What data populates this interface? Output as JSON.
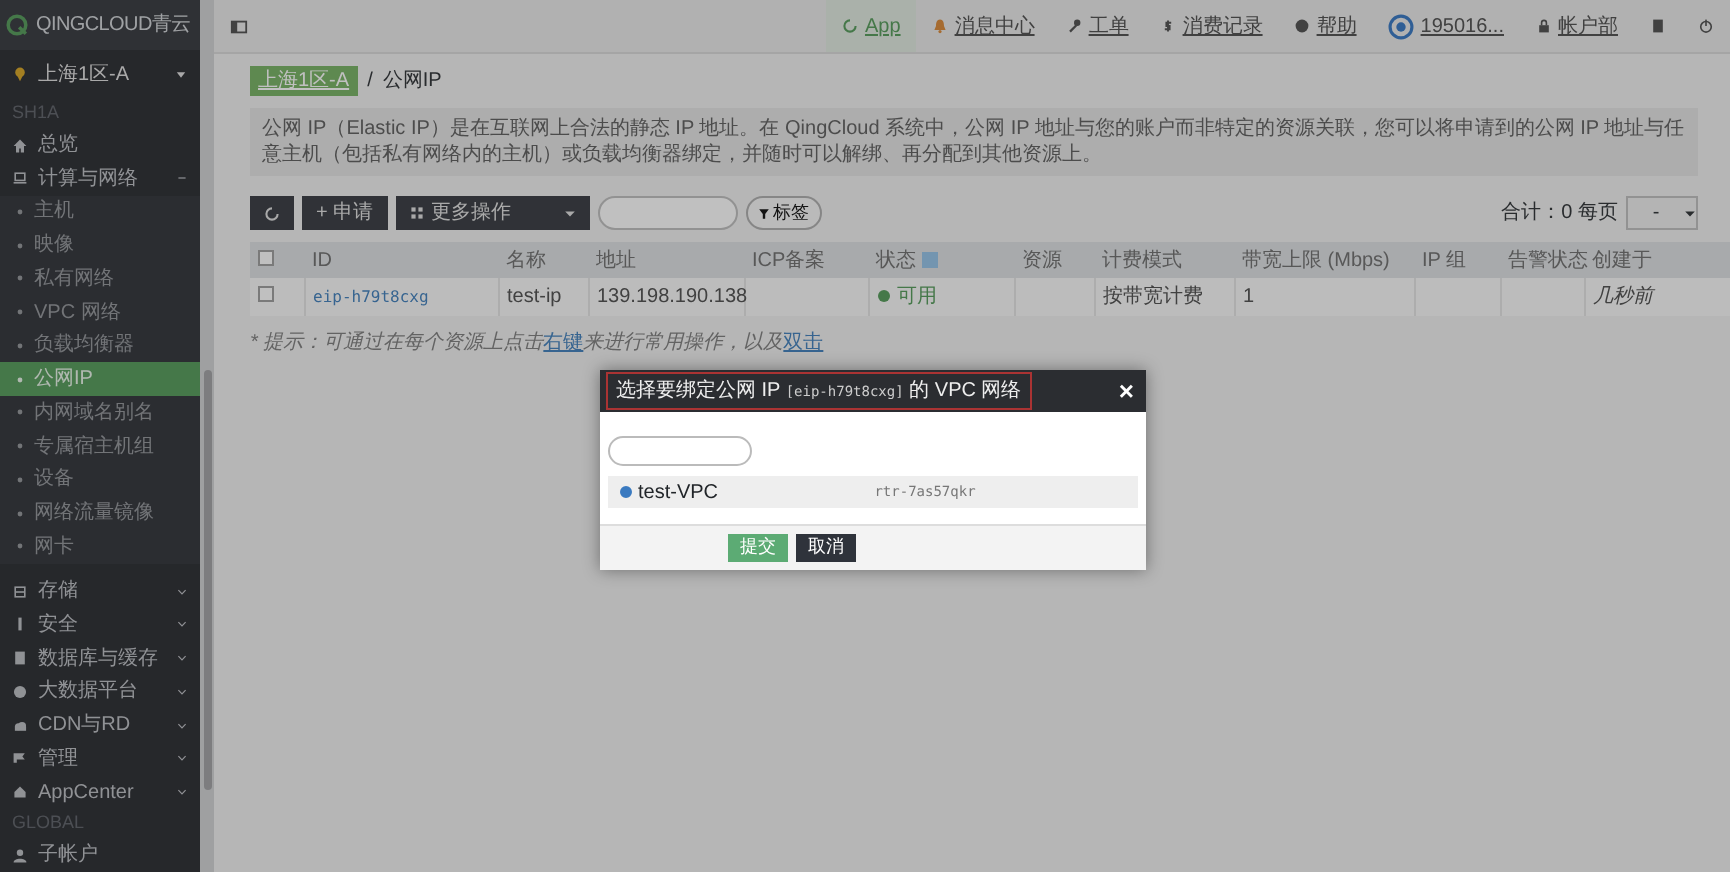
{
  "brand": "QINGCLOUD青云",
  "sidebar": {
    "region": "上海1区-A",
    "section": "SH1A",
    "global_section": "GLOBAL",
    "items": [
      {
        "label": "总览",
        "expanded": false,
        "selected": false
      },
      {
        "label": "计算与网络",
        "expanded": true,
        "selected": false,
        "children": [
          {
            "label": "主机",
            "selected": false
          },
          {
            "label": "映像",
            "selected": false
          },
          {
            "label": "私有网络",
            "selected": false
          },
          {
            "label": "VPC 网络",
            "selected": false
          },
          {
            "label": "负载均衡器",
            "selected": false
          },
          {
            "label": "公网IP",
            "selected": true
          },
          {
            "label": "内网域名别名",
            "selected": false
          },
          {
            "label": "专属宿主机组",
            "selected": false
          },
          {
            "label": "设备",
            "selected": false
          },
          {
            "label": "网络流量镜像",
            "selected": false
          },
          {
            "label": "网卡",
            "selected": false
          }
        ]
      },
      {
        "label": "存储",
        "expanded": false,
        "selected": false
      },
      {
        "label": "安全",
        "expanded": false,
        "selected": false
      },
      {
        "label": "数据库与缓存",
        "expanded": false,
        "selected": false
      },
      {
        "label": "大数据平台",
        "expanded": false,
        "selected": false
      },
      {
        "label": "CDN与RD",
        "expanded": false,
        "selected": false
      },
      {
        "label": "管理",
        "expanded": false,
        "selected": false
      },
      {
        "label": "AppCenter",
        "expanded": false,
        "selected": false
      }
    ],
    "global_items": [
      {
        "label": "子帐户",
        "selected": false
      }
    ]
  },
  "topnav": [
    {
      "label": "App",
      "selected": true
    },
    {
      "label": "消息中心",
      "selected": false
    },
    {
      "label": "工单",
      "selected": false
    },
    {
      "label": "消费记录",
      "selected": false
    },
    {
      "label": "帮助",
      "selected": false
    },
    {
      "label": "195016...",
      "selected": false
    },
    {
      "label": "帐户部",
      "selected": false
    }
  ],
  "breadcrumb": [
    "上海1区-A",
    "公网IP"
  ],
  "breadcrumb_separator": "/",
  "description": "公网 IP（Elastic IP）是在互联网上合法的静态 IP 地址。在 QingCloud 系统中，公网 IP 地址与您的账户而非特定的资源关联，您可以将申请到的公网 IP 地址与任意主机（包括私有网络内的主机）或负载均衡器绑定，并随时可以解绑、再分配到其他资源上。",
  "toolbar": {
    "apply": "+ 申请",
    "more": "更多操作",
    "tag_filter": "标签",
    "total": "合计：0 每页",
    "page_size": "-"
  },
  "table": {
    "select_all_checked": false,
    "columns": [
      "ID",
      "名称",
      "地址",
      "ICP备案",
      "状态",
      "资源",
      "计费模式",
      "带宽上限 (Mbps)",
      "IP 组",
      "告警状态",
      "创建于"
    ],
    "rows": [
      {
        "checked": false,
        "cells": [
          "eip-h79t8cxg",
          "test-ip",
          "139.198.190.138",
          "",
          "可用",
          "",
          "按带宽计费",
          "1",
          "",
          "",
          "几秒前"
        ]
      }
    ]
  },
  "hint": [
    {
      "kind": "text",
      "text": "* 提示：可通过在每个资源上点击"
    },
    {
      "kind": "link",
      "text": "右键"
    },
    {
      "kind": "text",
      "text": "来进行常用操作，以及"
    },
    {
      "kind": "link",
      "text": "双击"
    }
  ],
  "dialog": {
    "title": [
      {
        "kind": "text",
        "text": "选择要绑定公网 IP "
      },
      {
        "kind": "code",
        "text": "[eip-h79t8cxg]"
      },
      {
        "kind": "text",
        "text": " 的 VPC 网络"
      }
    ],
    "close": "×",
    "options": [
      {
        "name": "test-VPC",
        "id": "rtr-7as57qkr",
        "selected": true
      }
    ],
    "buttons": [
      {
        "label": "提交",
        "kind": "primary"
      },
      {
        "label": "取消",
        "kind": "secondary"
      }
    ]
  }
}
